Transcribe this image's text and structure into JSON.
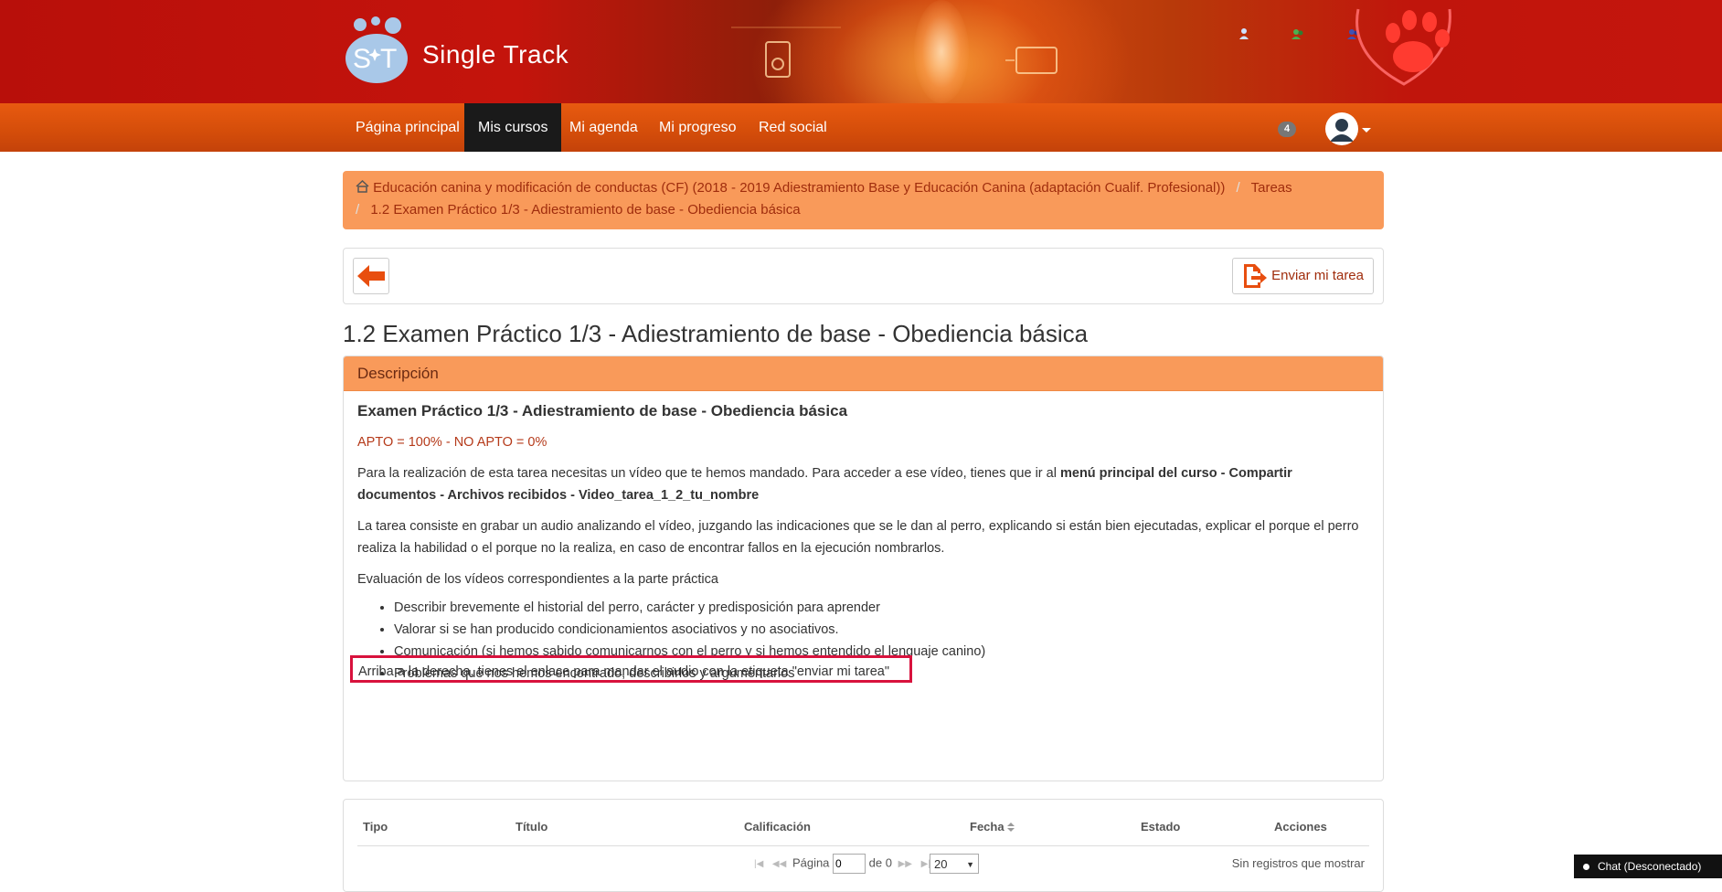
{
  "brand": {
    "name": "Single Track",
    "accent": "#e05a10",
    "header_red": "#c4140c"
  },
  "nav": {
    "items": [
      {
        "label": "Página principal"
      },
      {
        "label": "Mis cursos",
        "active": true
      },
      {
        "label": "Mi agenda"
      },
      {
        "label": "Mi progreso"
      },
      {
        "label": "Red social"
      }
    ],
    "badge_count": "4"
  },
  "breadcrumb": {
    "course": "Educación canina y modificación de conductas (CF) (2018 - 2019 Adiestramiento Base y Educación Canina (adaptación Cualif. Profesional))",
    "section": "Tareas",
    "current": "1.2 Examen Práctico 1/3 - Adiestramiento de base - Obediencia básica"
  },
  "toolbar": {
    "send_label": "Enviar mi tarea"
  },
  "page_title": "1.2 Examen Práctico 1/3 - Adiestramiento de base - Obediencia básica",
  "description": {
    "heading": "Descripción",
    "subtitle": "Examen Práctico 1/3 - Adiestramiento de base - Obediencia básica",
    "grading": "APTO = 100% - NO APTO = 0%",
    "para1_text": "Para la realización de esta tarea necesitas un vídeo que te hemos mandado. Para acceder a ese vídeo, tienes que ir al ",
    "para1_bold": "menú principal del curso - Compartir documentos - Archivos recibidos - Video_tarea_1_2_tu_nombre",
    "para2": "La tarea consiste en grabar un audio analizando el vídeo, juzgando las indicaciones que se le dan al perro, explicando si están bien ejecutadas, explicar el porque el perro realiza la habilidad o el porque no la realiza, en caso de encontrar fallos en la ejecución nombrarlos.",
    "para3": "Evaluación de los vídeos correspondientes a la parte práctica",
    "bullets": [
      "Describir brevemente el historial del perro, carácter y predisposición para aprender",
      "Valorar si se han producido condicionamientos asociativos y no asociativos.",
      "Comunicación (si hemos sabido comunicarnos con el perro y si hemos entendido el lenguaje canino)",
      "Problemas que nos hemos encontrado, describirlos y argumentarlos"
    ],
    "note": "Arriba a la derecha, tienes el enlace para mandar el audio con la etiqueta \"enviar mi tarea\""
  },
  "table": {
    "columns": [
      "Tipo",
      "Título",
      "Calificación",
      "Fecha",
      "Estado",
      "Acciones"
    ],
    "pager": {
      "page_label": "Página",
      "page_value": "0",
      "of_label": "de 0",
      "per_page": "20"
    },
    "empty_text": "Sin registros que mostrar"
  },
  "chat": {
    "label": "Chat (Desconectado)"
  }
}
